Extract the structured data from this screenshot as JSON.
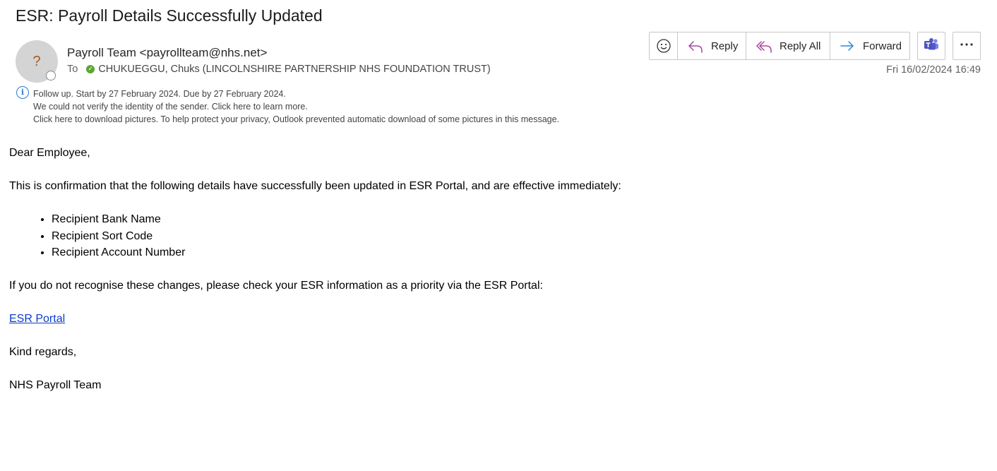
{
  "email": {
    "subject": "ESR: Payroll Details Successfully Updated",
    "avatar_initial": "?",
    "sender": "Payroll Team <payrollteam@nhs.net>",
    "to_label": "To",
    "recipient": "CHUKUEGGU, Chuks (LINCOLNSHIRE PARTNERSHIP NHS FOUNDATION TRUST)",
    "datetime": "Fri 16/02/2024 16:49"
  },
  "toolbar": {
    "reply_label": "Reply",
    "reply_all_label": "Reply All",
    "forward_label": "Forward",
    "icons": [
      "smiley-icon",
      "reply-icon",
      "reply-all-icon",
      "forward-icon",
      "teams-icon",
      "more-icon"
    ]
  },
  "infobar": {
    "follow_up": "Follow up.  Start by 27 February 2024.  Due by 27 February 2024.",
    "verify_warning": "We could not verify the identity of the sender. Click here to learn more.",
    "pictures_warning": "Click here to download pictures. To help protect your privacy, Outlook prevented automatic download of some pictures in this message."
  },
  "body": {
    "greeting": "Dear Employee,",
    "intro": "This is confirmation that the following details have successfully been updated in ESR Portal, and are effective immediately:",
    "items": [
      "Recipient Bank Name",
      "Recipient Sort Code",
      "Recipient Account Number"
    ],
    "instruction": "If you do not recognise these changes, please check your ESR information as a priority via the ESR Portal:",
    "link_text": "ESR Portal",
    "closing": "Kind regards,",
    "signature": "NHS Payroll Team"
  },
  "colors": {
    "reply_icon": "#a8479e",
    "forward_icon": "#2b88d8",
    "teams_icon": "#5059c9",
    "link": "#0b3cc9",
    "verified": "#5aa832",
    "info": "#2b7cd3"
  }
}
